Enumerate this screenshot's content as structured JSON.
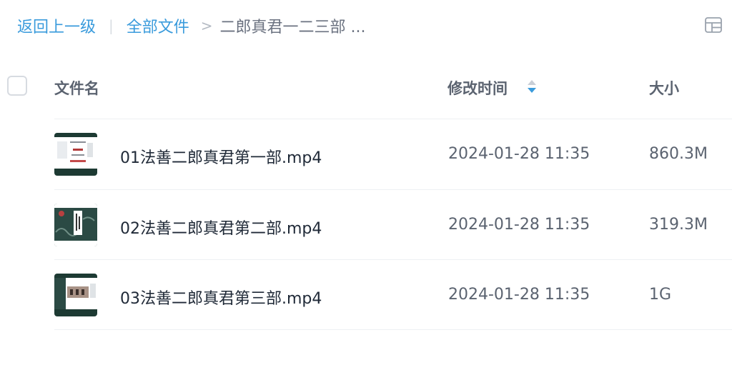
{
  "breadcrumb": {
    "back_label": "返回上一级",
    "separator": "|",
    "root_label": "全部文件",
    "arrow": ">",
    "current_label": "二郎真君一二三部 ..."
  },
  "toolbar": {
    "layout_icon": "grid-layout-icon"
  },
  "table": {
    "columns": {
      "name": "文件名",
      "modified": "修改时间",
      "size": "大小"
    },
    "sort_icon": "sort-icon",
    "rows": [
      {
        "name": "01法善二郎真君第一部.mp4",
        "modified": "2024-01-28 11:35",
        "size": "860.3M"
      },
      {
        "name": "02法善二郎真君第二部.mp4",
        "modified": "2024-01-28 11:35",
        "size": "319.3M"
      },
      {
        "name": "03法善二郎真君第三部.mp4",
        "modified": "2024-01-28 11:35",
        "size": "1G"
      }
    ]
  },
  "colors": {
    "link": "#3a9bdc",
    "sort_active": "#3a9bdc",
    "text_primary": "#1f2937",
    "text_secondary": "#5b6370"
  }
}
